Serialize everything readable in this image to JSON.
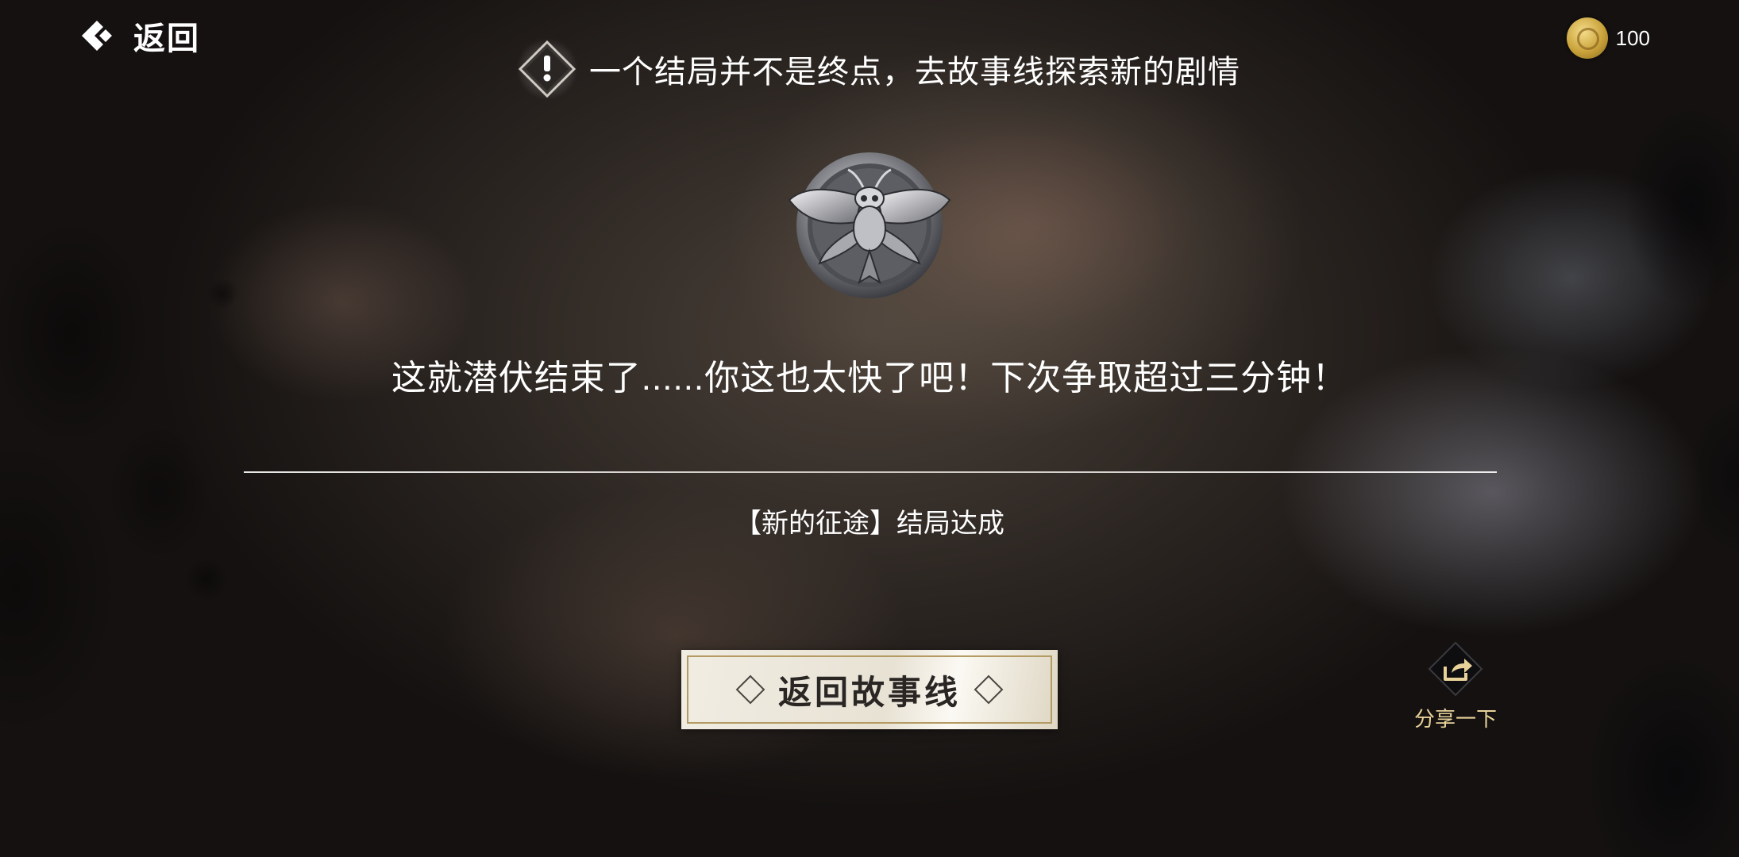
{
  "header": {
    "back_label": "返回",
    "coin_count": "100"
  },
  "hint": {
    "text": "一个结局并不是终点，去故事线探索新的剧情"
  },
  "ending": {
    "quote": "这就潜伏结束了......你这也太快了吧！下次争取超过三分钟！",
    "achieved_text": "【新的征途】结局达成"
  },
  "actions": {
    "return_storyline_label": "返回故事线",
    "share_label": "分享一下"
  },
  "colors": {
    "coin_gold": "#c9a23a",
    "button_bg": "#f1ede3",
    "button_border": "#b39b63",
    "share_label": "#e8d29a"
  },
  "icons": {
    "back": "chevron-left-icon",
    "coin": "coin-icon",
    "hint": "exclamation-diamond-icon",
    "badge": "bee-emblem-badge",
    "share": "share-arrow-icon"
  }
}
